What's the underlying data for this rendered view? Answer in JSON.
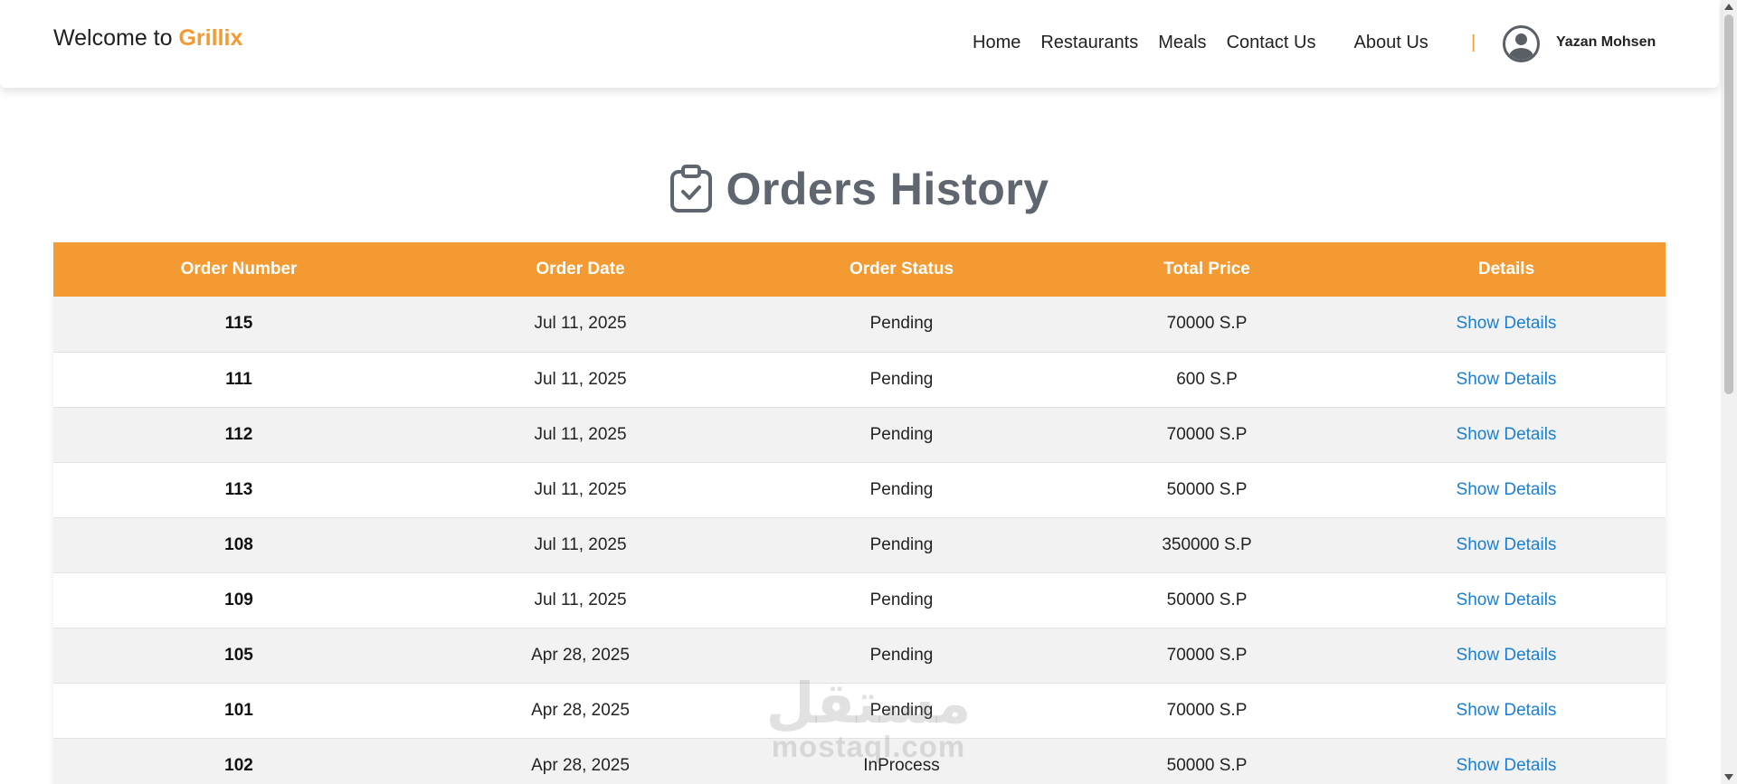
{
  "header": {
    "brand_prefix": "Welcome to",
    "brand_name": "Grillix",
    "nav": [
      "Home",
      "Restaurants",
      "Meals",
      "Contact Us",
      "About Us"
    ],
    "separator": "|",
    "user_name": "Yazan Mohsen"
  },
  "page": {
    "title": "Orders History",
    "title_icon": "clipboard-check-icon"
  },
  "table": {
    "columns": [
      "Order Number",
      "Order Date",
      "Order Status",
      "Total Price",
      "Details"
    ],
    "rows": [
      {
        "number": "115",
        "date": "Jul 11, 2025",
        "status": "Pending",
        "price": "70000 S.P",
        "details": "Show Details"
      },
      {
        "number": "111",
        "date": "Jul 11, 2025",
        "status": "Pending",
        "price": "600 S.P",
        "details": "Show Details"
      },
      {
        "number": "112",
        "date": "Jul 11, 2025",
        "status": "Pending",
        "price": "70000 S.P",
        "details": "Show Details"
      },
      {
        "number": "113",
        "date": "Jul 11, 2025",
        "status": "Pending",
        "price": "50000 S.P",
        "details": "Show Details"
      },
      {
        "number": "108",
        "date": "Jul 11, 2025",
        "status": "Pending",
        "price": "350000 S.P",
        "details": "Show Details"
      },
      {
        "number": "109",
        "date": "Jul 11, 2025",
        "status": "Pending",
        "price": "50000 S.P",
        "details": "Show Details"
      },
      {
        "number": "105",
        "date": "Apr 28, 2025",
        "status": "Pending",
        "price": "70000 S.P",
        "details": "Show Details"
      },
      {
        "number": "101",
        "date": "Apr 28, 2025",
        "status": "Pending",
        "price": "70000 S.P",
        "details": "Show Details"
      },
      {
        "number": "102",
        "date": "Apr 28, 2025",
        "status": "InProcess",
        "price": "50000 S.P",
        "details": "Show Details"
      }
    ]
  },
  "watermark": {
    "arabic": "مستقل",
    "latin": "mostaql.com"
  },
  "colors": {
    "accent": "#f39a32",
    "link": "#1a7fd4",
    "title": "#5f6670"
  }
}
